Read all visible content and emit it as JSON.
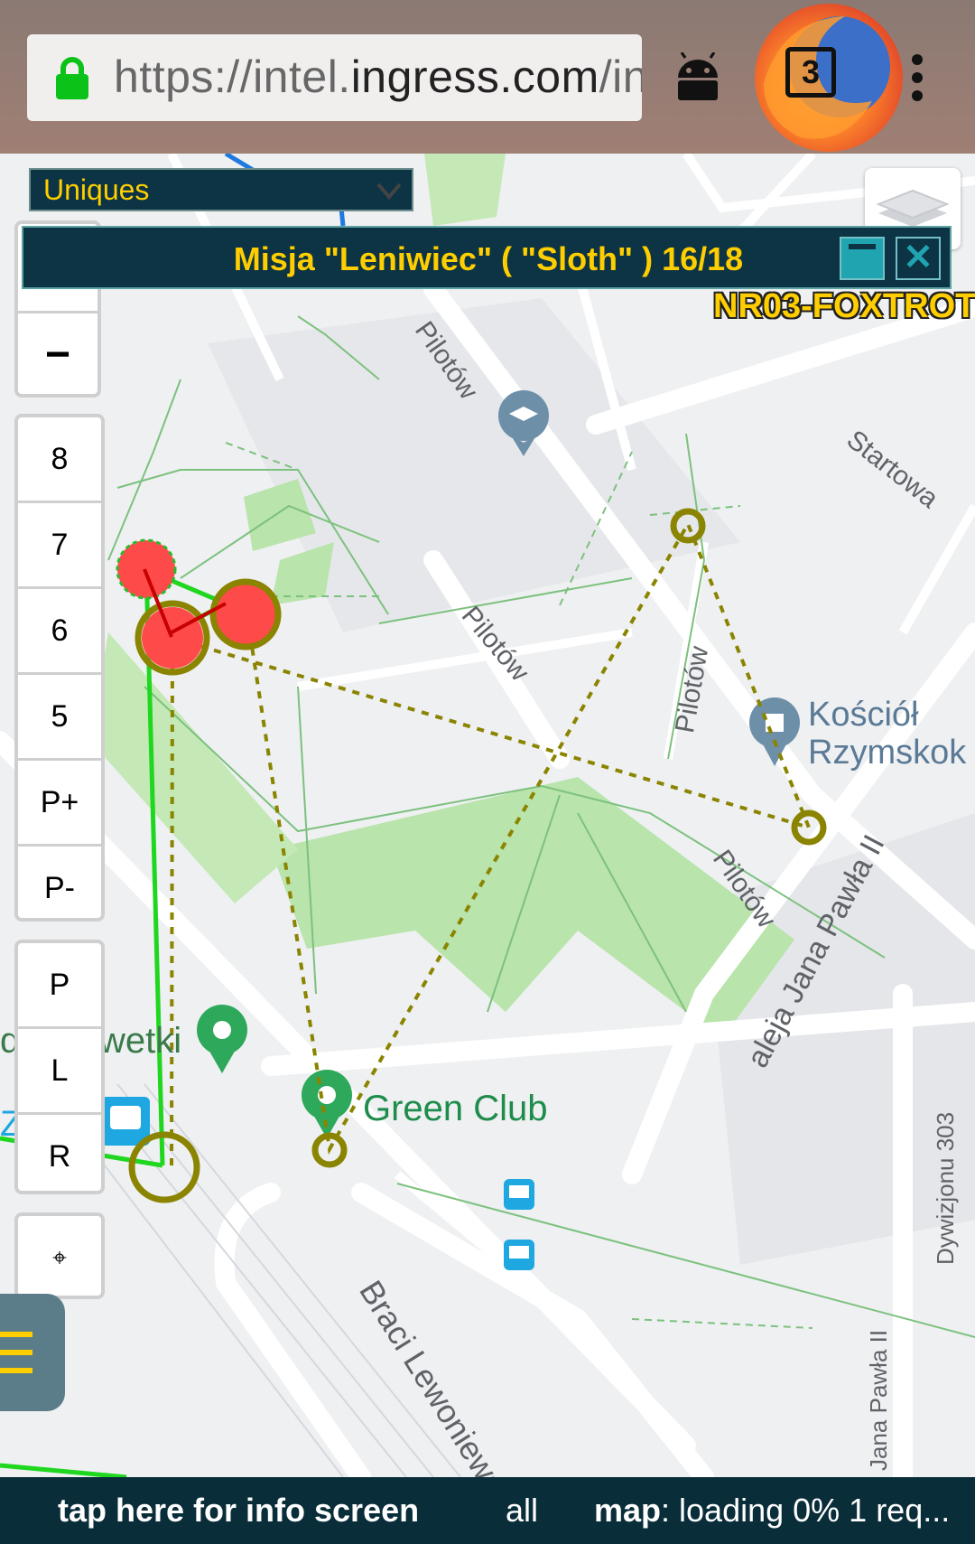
{
  "browser": {
    "url_prefix": "https://intel.",
    "url_host": "ingress.com",
    "url_suffix": "/in",
    "tab_count": "3",
    "icons": [
      "lock-icon",
      "android-icon",
      "firefox-logo",
      "tabs-icon",
      "menu-dots-icon"
    ]
  },
  "filter_select": {
    "value": "Uniques"
  },
  "mission": {
    "title": "Misja \"Leniwiec\" ( \"Sloth\" ) 16/18",
    "minimize_icon": "minimize-icon",
    "close_icon": "close-icon"
  },
  "portal_label": "NR03-FOXTROT",
  "map_controls": {
    "zoom_out": "−",
    "levels": [
      "8",
      "7",
      "6",
      "5",
      "P+",
      "P-"
    ],
    "layers": [
      "P",
      "L",
      "R"
    ],
    "locate": "⌖"
  },
  "map_labels": {
    "streets": [
      "Pilotów",
      "Pilotów",
      "Pilotów",
      "Pilotów",
      "Startowa",
      "aleja Jana Pawła II",
      "Braci Lewoniewsk",
      "Dywizjonu 303",
      "Jana Pawła II"
    ],
    "poi_kosciol_1": "Kościół",
    "poi_kosciol_2": "Rzymskok",
    "poi_green_club": "Green Club",
    "poi_partial_1": "di",
    "poi_partial_2": "wetki",
    "poi_partial_3": "Za"
  },
  "colors": {
    "panel_bg": "#0c3444",
    "accent_yellow": "#ffce00",
    "link_green": "#00e000",
    "portal_red": "#ff4444",
    "waypoint_olive": "#8a8400",
    "park_green": "#b4e3a6"
  },
  "status_bar": {
    "info": "tap here for info screen",
    "filter": "all",
    "map_label": "map",
    "map_status": ": loading 0% 1 req..."
  }
}
